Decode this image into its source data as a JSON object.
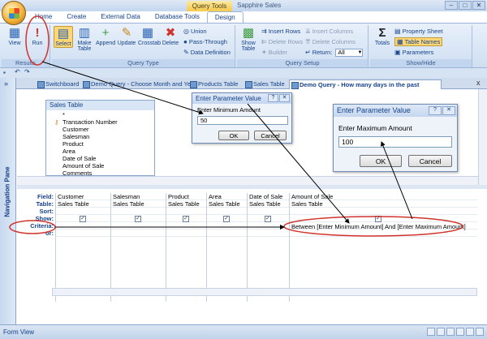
{
  "app": {
    "title": "Sapphire Sales",
    "tool_label": "Query Tools",
    "window_buttons": [
      "–",
      "□",
      "✕"
    ]
  },
  "ribbon": {
    "tabs": [
      "Home",
      "Create",
      "External Data",
      "Database Tools",
      "Design"
    ],
    "active_tab": "Design",
    "groups": {
      "results": {
        "label": "Results",
        "view": "View",
        "run": "Run"
      },
      "query_type": {
        "label": "Query Type",
        "select": "Select",
        "make_table_line1": "Make",
        "make_table_line2": "Table",
        "append": "Append",
        "update": "Update",
        "crosstab": "Crosstab",
        "delete": "Delete",
        "union": "Union",
        "pass_through": "Pass-Through",
        "data_definition": "Data Definition"
      },
      "query_setup": {
        "label": "Query Setup",
        "show_table_line1": "Show",
        "show_table_line2": "Table",
        "insert_rows": "Insert Rows",
        "delete_rows": "Delete Rows",
        "builder": "Builder",
        "insert_columns": "Insert Columns",
        "delete_columns": "Delete Columns",
        "return_label": "Return:",
        "return_value": "All"
      },
      "show_hide": {
        "label": "Show/Hide",
        "totals": "Totals",
        "property_sheet": "Property Sheet",
        "table_names": "Table Names",
        "parameters": "Parameters"
      }
    }
  },
  "nav_pane": {
    "label": "Navigation Pane",
    "toggle": "»"
  },
  "doc_tabs": [
    "Switchboard",
    "Demo Query - Choose Month and Year",
    "Products Table",
    "Sales Table",
    "Demo Query - How many days in the past"
  ],
  "doc_close": "x",
  "table_box": {
    "title": "Sales Table",
    "fields": [
      "*",
      "Transaction Number",
      "Customer",
      "Salesman",
      "Product",
      "Area",
      "Date of Sale",
      "Amount of Sale",
      "Comments"
    ]
  },
  "grid": {
    "row_labels": [
      "Field:",
      "Table:",
      "Sort:",
      "Show:",
      "Criteria:",
      "or:"
    ],
    "columns": [
      {
        "field": "Customer",
        "table": "Sales Table",
        "show": true,
        "criteria": ""
      },
      {
        "field": "Salesman",
        "table": "Sales Table",
        "show": true,
        "criteria": ""
      },
      {
        "field": "Product",
        "table": "Sales Table",
        "show": true,
        "criteria": ""
      },
      {
        "field": "Area",
        "table": "Sales Table",
        "show": true,
        "criteria": ""
      },
      {
        "field": "Date of Sale",
        "table": "Sales Table",
        "show": true,
        "criteria": ""
      },
      {
        "field": "Amount of Sale",
        "table": "Sales Table",
        "show": true,
        "criteria": "Between [Enter Minimum Amount] And [Enter Maximum Amount]"
      }
    ]
  },
  "dialog_min": {
    "title": "Enter Parameter Value",
    "prompt": "Enter Minimum Amount",
    "value": "50",
    "ok": "OK",
    "cancel": "Cancel",
    "help": "?",
    "close": "✕"
  },
  "dialog_max": {
    "title": "Enter Parameter Value",
    "prompt": "Enter Maximum Amount",
    "value": "100",
    "ok": "OK",
    "cancel": "Cancel",
    "help": "?",
    "close": "✕"
  },
  "status_bar": {
    "text": "Form View"
  },
  "annotation_color": "#d0342c"
}
